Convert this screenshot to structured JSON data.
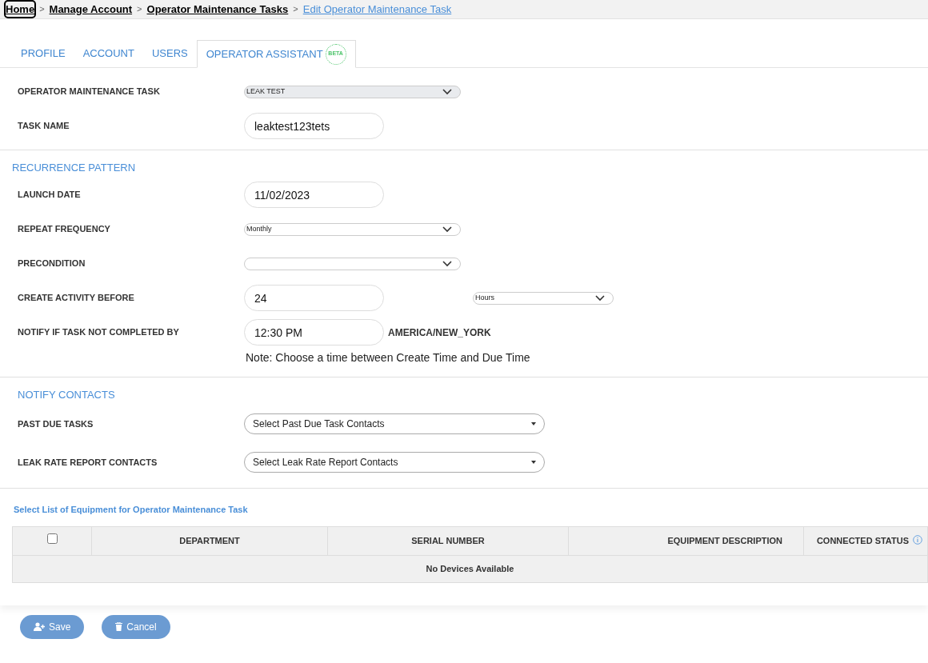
{
  "breadcrumbs": [
    {
      "label": "Home",
      "current": false,
      "focused": true
    },
    {
      "label": "Manage Account",
      "current": false,
      "focused": false
    },
    {
      "label": "Operator Maintenance Tasks",
      "current": false,
      "focused": false
    },
    {
      "label": "Edit Operator Maintenance Task",
      "current": true,
      "focused": false
    }
  ],
  "breadcrumb_separator": ">",
  "tabs": [
    {
      "label": "PROFILE",
      "selected": false
    },
    {
      "label": "ACCOUNT",
      "selected": false
    },
    {
      "label": "USERS",
      "selected": false
    },
    {
      "label": "OPERATOR ASSISTANT",
      "selected": true,
      "badge": "BETA"
    }
  ],
  "sections": [
    {
      "fields": [
        {
          "kind": "select",
          "label": "OPERATOR MAINTENANCE TASK",
          "value": "LEAK TEST",
          "disabled": true
        },
        {
          "kind": "input",
          "label": "TASK NAME",
          "value": "leaktest123tets"
        }
      ]
    },
    {
      "heading": "RECURRENCE PATTERN",
      "fields": [
        {
          "kind": "input",
          "label": "LAUNCH DATE",
          "value": "11/02/2023"
        },
        {
          "kind": "select",
          "label": "REPEAT FREQUENCY",
          "value": "Monthly",
          "disabled": false
        },
        {
          "kind": "select",
          "label": "PRECONDITION",
          "disabled": false
        },
        {
          "kind": "input_select",
          "label": "CREATE ACTIVITY BEFORE",
          "value": "24",
          "unit": "Hours"
        },
        {
          "kind": "input_suffix",
          "label": "NOTIFY IF TASK NOT COMPLETED BY",
          "value": "12:30 PM",
          "suffix": "AMERICA/NEW_YORK",
          "note": "Note: Choose a time between Create Time and Due Time"
        }
      ]
    },
    {
      "heading": "NOTIFY CONTACTS",
      "fields": [
        {
          "kind": "multiselect",
          "label": "PAST DUE TASKS",
          "value": "Select Past Due Task Contacts"
        },
        {
          "kind": "multiselect",
          "label": "LEAK RATE REPORT CONTACTS",
          "value": "Select Leak Rate Report Contacts"
        }
      ]
    }
  ],
  "equipment": {
    "title": "Select List of Equipment for Operator Maintenance Task",
    "select_all_checked": false,
    "columns": [
      {
        "label": "DEPARTMENT",
        "info": false
      },
      {
        "label": "SERIAL NUMBER",
        "info": false
      },
      {
        "label": "EQUIPMENT DESCRIPTION",
        "info": false
      },
      {
        "label": "CONNECTED STATUS",
        "info": true
      }
    ],
    "empty_message": "No Devices Available"
  },
  "buttons": [
    {
      "label": "Save",
      "kind": "save"
    },
    {
      "label": "Cancel",
      "kind": "cancel"
    }
  ]
}
